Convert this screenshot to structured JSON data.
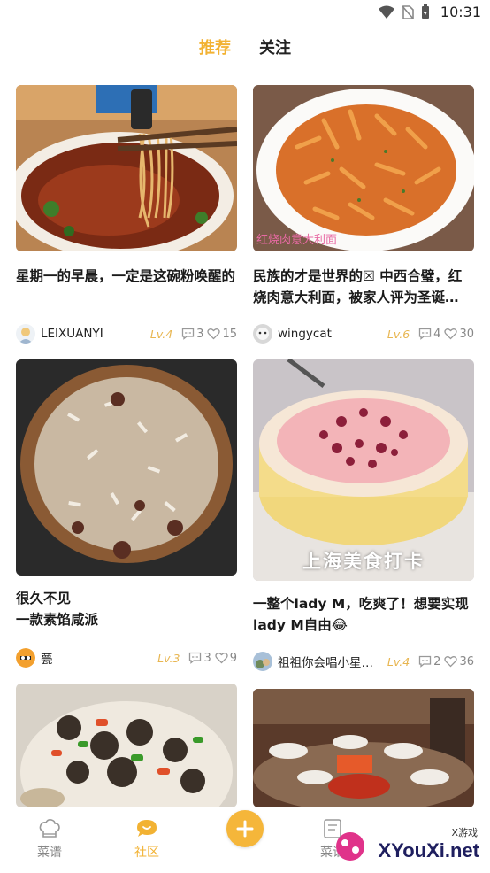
{
  "status_bar": {
    "time": "10:31"
  },
  "top_tabs": [
    {
      "label": "推荐",
      "active": true
    },
    {
      "label": "关注",
      "active": false
    }
  ],
  "posts": [
    {
      "title": "星期一的早晨，一定是这碗粉唤醒的",
      "author": "LEIXUANYI",
      "level": "Lv.4",
      "comments": "3",
      "likes": "15"
    },
    {
      "title": "民族的才是世界的☒ 中西合璧，红烧肉意大利面，被家人评为圣诞…",
      "author": "wingycat",
      "level": "Lv.6",
      "comments": "4",
      "likes": "30",
      "image_caption": "红烧肉意大利面"
    },
    {
      "title": "很久不见\n一款素馅咸派",
      "author": "甍",
      "level": "Lv.3",
      "comments": "3",
      "likes": "9"
    },
    {
      "title": "一整个lady M，吃爽了！想要实现lady M自由😂",
      "author": "祖祖你会唱小星…",
      "level": "Lv.4",
      "comments": "2",
      "likes": "36",
      "image_caption": "上海美食打卡"
    }
  ],
  "bottom_nav": [
    {
      "label": "菜谱",
      "icon": "chef-hat-icon",
      "active": false
    },
    {
      "label": "社区",
      "icon": "chat-bubble-icon",
      "active": true
    },
    {
      "label": "菜谱",
      "icon": "recipe-book-icon",
      "active": false
    }
  ],
  "watermark": {
    "brand": "XYouXi.net",
    "tag": "X游戏"
  },
  "colors": {
    "accent": "#f2b233",
    "level": "#e8b651"
  }
}
